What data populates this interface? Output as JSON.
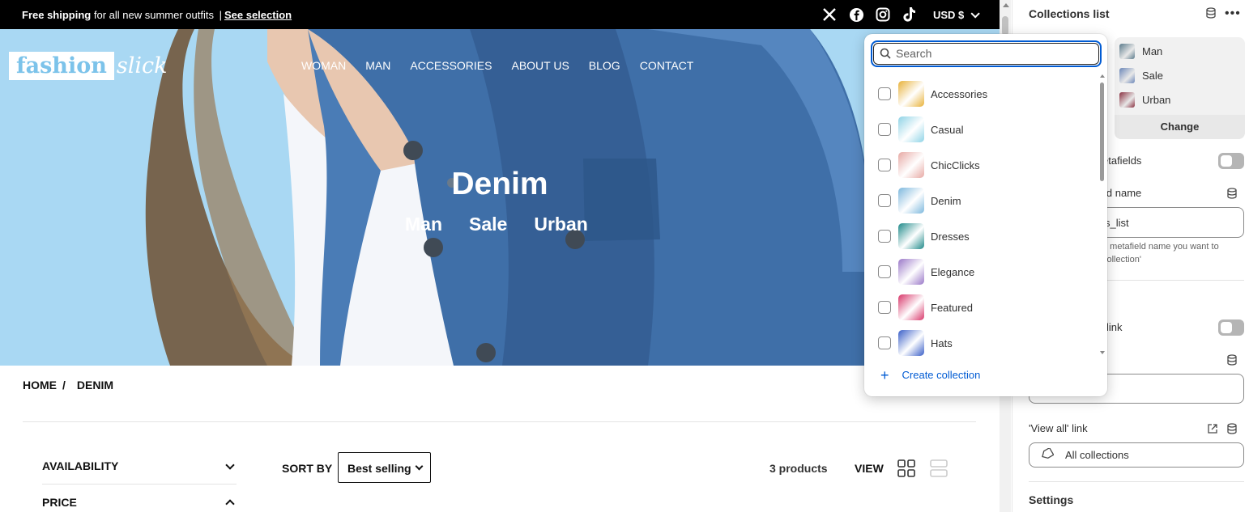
{
  "announcement": {
    "bold": "Free shipping",
    "text": "for all new summer outfits",
    "separator": "|",
    "link": "See selection"
  },
  "social_icons": [
    "x-icon",
    "facebook-icon",
    "instagram-icon",
    "tiktok-icon"
  ],
  "currency": "USD $",
  "logo": {
    "part1": "fashion",
    "part2": "slick"
  },
  "nav": [
    "WOMAN",
    "MAN",
    "ACCESSORIES",
    "ABOUT US",
    "BLOG",
    "CONTACT"
  ],
  "hero": {
    "title": "Denim",
    "links": [
      "Man",
      "Sale",
      "Urban"
    ]
  },
  "breadcrumb": {
    "home": "HOME",
    "separator": "/",
    "current": "DENIM"
  },
  "filters": {
    "availability": "AVAILABILITY",
    "price": "PRICE"
  },
  "sort": {
    "label": "SORT BY",
    "value": "Best selling"
  },
  "product_count": "3 products",
  "view_label": "VIEW",
  "panel": {
    "title": "Collections list",
    "selected": [
      {
        "name": "Man",
        "color": "#5a7a8c"
      },
      {
        "name": "Sale",
        "color": "#6a86b8"
      },
      {
        "name": "Urban",
        "color": "#8a3040"
      }
    ],
    "change_label": "Change",
    "metafields_partial": "etafields",
    "field_name_partial": "ld name",
    "field_value_partial": "s_list",
    "help_line1": "d metafield name you want to",
    "help_line2": "collection'",
    "link_partial": "link",
    "view_all_label": "'View all' link",
    "view_all_value": "All collections",
    "settings": "Settings"
  },
  "dropdown": {
    "search_placeholder": "Search",
    "options": [
      {
        "label": "Accessories",
        "color": "#e8b23a"
      },
      {
        "label": "Casual",
        "color": "#8fd3e6"
      },
      {
        "label": "ChicClicks",
        "color": "#e7a9a4"
      },
      {
        "label": "Denim",
        "color": "#7db8dd"
      },
      {
        "label": "Dresses",
        "color": "#1f8a8a"
      },
      {
        "label": "Elegance",
        "color": "#9a78c8"
      },
      {
        "label": "Featured",
        "color": "#d8376a"
      },
      {
        "label": "Hats",
        "color": "#3a5fc8"
      }
    ],
    "create_label": "Create collection"
  }
}
